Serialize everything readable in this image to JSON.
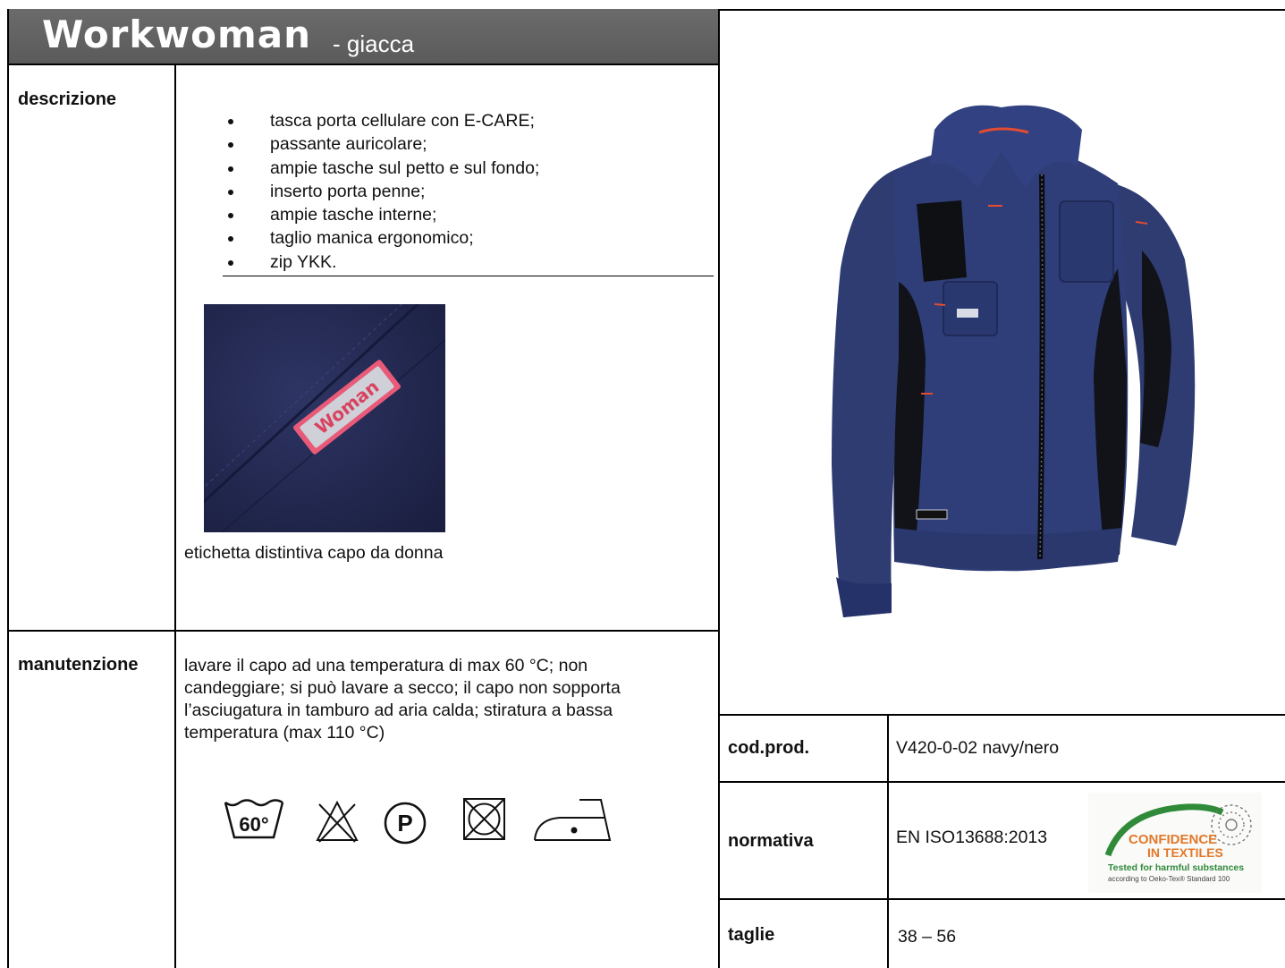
{
  "header": {
    "product_name": "Workwoman",
    "product_type": "-  giacca"
  },
  "descrizione": {
    "label": "descrizione",
    "features": [
      "tasca porta cellulare con E-CARE;",
      "passante auricolare;",
      "ampie tasche sul petto e sul fondo;",
      "inserto porta penne;",
      "ampie tasche interne;",
      "taglio manica ergonomico;",
      "zip YKK."
    ],
    "label_tag_text": "Woman",
    "photo_caption": "etichetta distintiva capo da donna"
  },
  "manutenzione": {
    "label": "manutenzione",
    "text": "lavare il capo ad una temperatura di max 60 °C; non candeggiare; si può lavare a secco; il capo non sopporta l’asciugatura in tamburo ad aria calda; stiratura a bassa temperatura (max 110 °C)",
    "care_symbols": {
      "wash_temp": "60°",
      "dryclean_letter": "P",
      "icons": [
        "wash-60-icon",
        "no-bleach-icon",
        "dry-clean-p-icon",
        "no-tumble-dry-icon",
        "iron-low-icon"
      ]
    }
  },
  "specs": {
    "codprod_label": "cod.prod.",
    "codprod_value": "V420-0-02 navy/nero",
    "normativa_label": "normativa",
    "normativa_value": "EN ISO13688:2013",
    "taglie_label": "taglie",
    "taglie_value": "38 – 56"
  },
  "oeko_logo": {
    "line1": "CONFIDENCE",
    "line2": "IN TEXTILES",
    "line3": "Tested for harmful substances",
    "line4": "according to Oeko-Tex® Standard 100"
  },
  "colors": {
    "header_bg": "#5f5f5f",
    "navy": "#2b3a6e",
    "oeko_green": "#2f8a3a",
    "oeko_orange": "#e2792a"
  }
}
